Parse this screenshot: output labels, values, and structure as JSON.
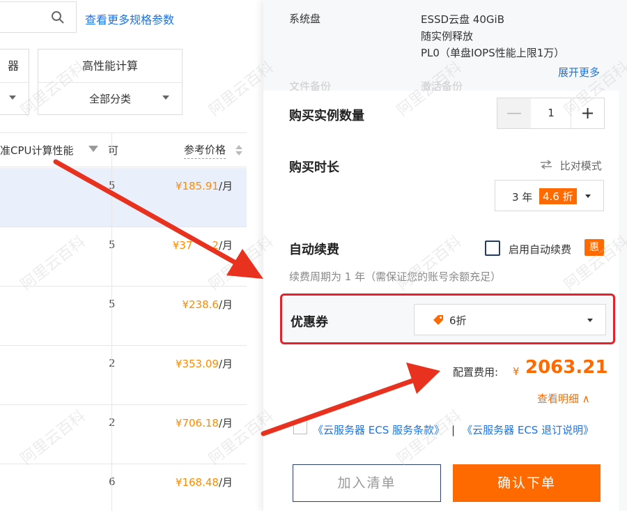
{
  "search": {
    "more_specs_link": "查看更多规格参数"
  },
  "filters": [
    {
      "title": "器",
      "value": ""
    },
    {
      "title": "高性能计算",
      "value": "全部分类"
    }
  ],
  "table": {
    "headers": {
      "cpu": "准CPU计算性能",
      "avail": "可",
      "price": "参考价格"
    },
    "rows": [
      {
        "avail": "5",
        "price": "¥185.91",
        "unit": "/月",
        "selected": true
      },
      {
        "avail": "5",
        "price": "¥37",
        "price_tail": "2",
        "unit": "/月",
        "selected": false
      },
      {
        "avail": "5",
        "price": "¥238.6",
        "unit": "/月",
        "selected": false
      },
      {
        "avail": "2",
        "price": "¥353.09",
        "unit": "/月",
        "selected": false
      },
      {
        "avail": "2",
        "price": "¥706.18",
        "unit": "/月",
        "selected": false
      },
      {
        "avail": "6",
        "price": "¥168.48",
        "unit": "/月",
        "selected": false
      }
    ]
  },
  "config": {
    "system_disk_label": "系统盘",
    "system_disk_lines": [
      "ESSD云盘 40GiB",
      "随实例释放",
      "PL0（单盘IOPS性能上限1万）"
    ],
    "expand_more": "展开更多",
    "faded_label": "文件备份",
    "faded_value": "激活备份"
  },
  "purchase": {
    "qty_label": "购买实例数量",
    "qty_value": "1",
    "qty_minus": "—",
    "qty_plus": "+",
    "duration_label": "购买时长",
    "compare_mode": "比对模式",
    "duration_value": "3 年",
    "duration_discount": "4.6 折",
    "auto_renew_label": "自动续费",
    "auto_renew_checkbox": "启用自动续费",
    "auto_renew_badge": "惠",
    "renew_note": "续费周期为 1 年（需保证您的账号余额充足）",
    "coupon_label": "优惠券",
    "coupon_value": "6折",
    "config_fee_label": "配置费用:",
    "currency": "¥",
    "total": "2063.21",
    "view_detail": "查看明细 ∧",
    "terms_1": "《云服务器 ECS 服务条款》",
    "terms_sep": "|",
    "terms_2": "《云服务器 ECS 退订说明》",
    "add_to_list": "加入清单",
    "confirm_order": "确认下单"
  },
  "watermark": "阿里云百科",
  "colors": {
    "accent": "#ff6a00",
    "link": "#1a73e8",
    "highlight_border": "#e8202a",
    "arrow": "#e8321f"
  }
}
